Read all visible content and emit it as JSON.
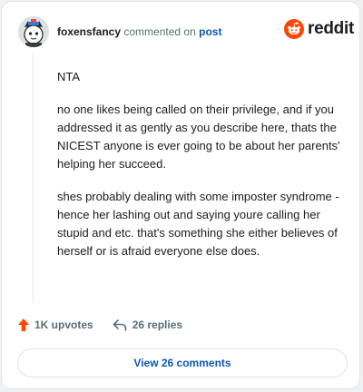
{
  "comment": {
    "username": "foxensfancy",
    "action_text": "commented on",
    "target_link": "post",
    "paragraphs": [
      "NTA",
      "no one likes being called on their privilege, and if you addressed it as gently as you describe here, thats the NICEST anyone is ever going to be about her parents' helping her succeed.",
      "shes probably dealing with some imposter syndrome - hence her lashing out and saying youre calling her stupid and etc. that's something she either believes of herself or is afraid everyone else does."
    ]
  },
  "brand": {
    "wordmark": "reddit",
    "accent_color": "#ff4500"
  },
  "actions": {
    "upvotes": "1K upvotes",
    "replies": "26 replies"
  },
  "view_button": {
    "label": "View 26 comments"
  },
  "colors": {
    "link": "#0a58b4",
    "muted": "#576f76",
    "upvote": "#ff4500"
  },
  "icons": [
    "avatar-icon",
    "reddit-alien-icon",
    "upvote-arrow-icon",
    "reply-arrow-icon"
  ]
}
